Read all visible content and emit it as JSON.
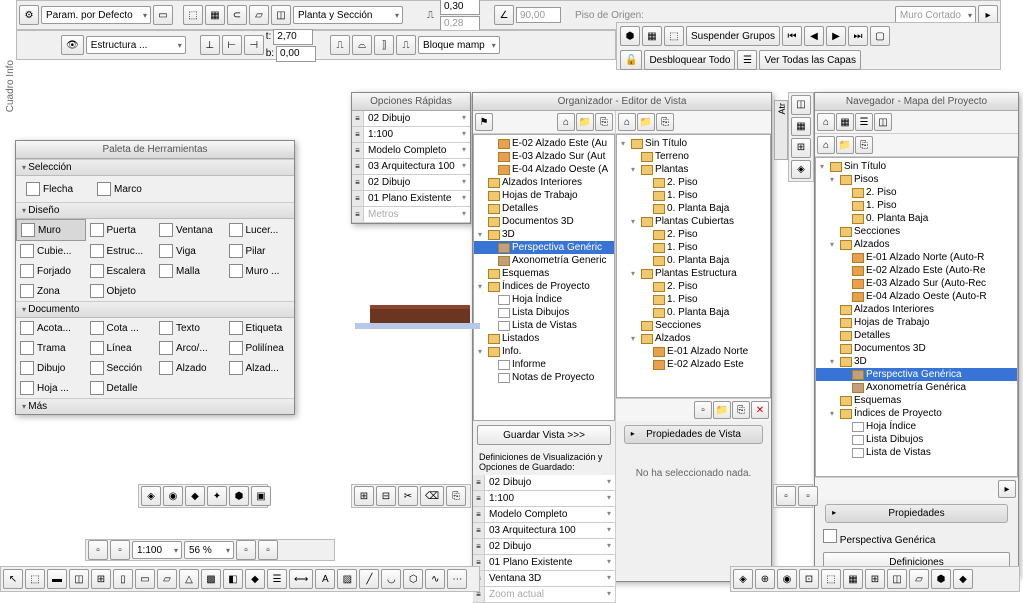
{
  "top": {
    "param_default": "Param. por Defecto",
    "planta_seccion": "Planta y Sección",
    "estruct": "Estructura ...",
    "bloque": "Bloque mamp",
    "t_label": "t:",
    "t_val": "2,70",
    "b_label": "b:",
    "b_val": "0,00",
    "v1": "0,30",
    "v2": "0,28",
    "angle": "90,00",
    "piso_origen": "Piso de Origen:",
    "muro_cortado": "Muro Cortado",
    "info": "Cuadro Info"
  },
  "layers": {
    "suspend": "Suspender Grupos",
    "unlock": "Desbloquear Todo",
    "showall": "Ver Todas las Capas"
  },
  "palette": {
    "title": "Paleta de Herramientas",
    "sections": {
      "sel": "Selección",
      "design": "Diseño",
      "doc": "Documento",
      "more": "Más"
    },
    "flecha": "Flecha",
    "marco": "Marco",
    "muro": "Muro",
    "puerta": "Puerta",
    "ventana": "Ventana",
    "lucer": "Lucer...",
    "cubie": "Cubie...",
    "estruc": "Estruc...",
    "viga": "Viga",
    "pilar": "Pilar",
    "forjado": "Forjado",
    "escalera": "Escalera",
    "malla": "Malla",
    "muroc": "Muro ...",
    "zona": "Zona",
    "objeto": "Objeto",
    "acota": "Acota...",
    "cota": "Cota ...",
    "texto": "Texto",
    "etiqueta": "Etiqueta",
    "trama": "Trama",
    "linea": "Línea",
    "arco": "Arco/...",
    "polilinea": "Polilínea",
    "dibujo": "Dibujo",
    "seccion": "Sección",
    "alzado": "Alzado",
    "alzad2": "Alzad...",
    "hoja": "Hoja ...",
    "detalle": "Detalle"
  },
  "opciones": {
    "title": "Opciones Rápidas",
    "items": [
      "02 Dibujo",
      "1:100",
      "Modelo Completo",
      "03 Arquitectura 100",
      "02 Dibujo",
      "01 Plano Existente",
      "Metros"
    ]
  },
  "organizador": {
    "title": "Organizador - Editor de Vista",
    "left_tree": [
      {
        "l": 1,
        "i": "home",
        "t": "E-02 Alzado Este (Au"
      },
      {
        "l": 1,
        "i": "home",
        "t": "E-03 Alzado Sur (Aut"
      },
      {
        "l": 1,
        "i": "home",
        "t": "E-04 Alzado Oeste (A"
      },
      {
        "l": 0,
        "i": "f",
        "t": "Alzados Interiores"
      },
      {
        "l": 0,
        "i": "f",
        "t": "Hojas de Trabajo"
      },
      {
        "l": 0,
        "i": "f",
        "t": "Detalles"
      },
      {
        "l": 0,
        "i": "f",
        "t": "Documentos 3D"
      },
      {
        "l": 0,
        "tri": "▾",
        "i": "f",
        "t": "3D"
      },
      {
        "l": 1,
        "i": "cube",
        "t": "Perspectiva Genéric",
        "sel": true
      },
      {
        "l": 1,
        "i": "cube",
        "t": "Axonometría Generic"
      },
      {
        "l": 0,
        "i": "f",
        "t": "Esquemas"
      },
      {
        "l": 0,
        "tri": "▾",
        "i": "f",
        "t": "Índices de Proyecto"
      },
      {
        "l": 1,
        "i": "doc",
        "t": "Hoja Índice"
      },
      {
        "l": 1,
        "i": "doc",
        "t": "Lista Dibujos"
      },
      {
        "l": 1,
        "i": "doc",
        "t": "Lista de Vistas"
      },
      {
        "l": 0,
        "i": "f",
        "t": "Listados"
      },
      {
        "l": 0,
        "tri": "▾",
        "i": "f",
        "t": "Info."
      },
      {
        "l": 1,
        "i": "doc",
        "t": "Informe"
      },
      {
        "l": 1,
        "i": "doc",
        "t": "Notas de Proyecto"
      }
    ],
    "right_tree": [
      {
        "l": 0,
        "tri": "▾",
        "i": "f",
        "t": "Sin Título"
      },
      {
        "l": 1,
        "i": "f",
        "t": "Terreno"
      },
      {
        "l": 1,
        "tri": "▾",
        "i": "f",
        "t": "Plantas"
      },
      {
        "l": 2,
        "i": "f",
        "t": "2. Piso"
      },
      {
        "l": 2,
        "i": "f",
        "t": "1. Piso"
      },
      {
        "l": 2,
        "i": "f",
        "t": "0. Planta Baja"
      },
      {
        "l": 1,
        "tri": "▾",
        "i": "f",
        "t": "Plantas Cubiertas"
      },
      {
        "l": 2,
        "i": "f",
        "t": "2. Piso"
      },
      {
        "l": 2,
        "i": "f",
        "t": "1. Piso"
      },
      {
        "l": 2,
        "i": "f",
        "t": "0. Planta Baja"
      },
      {
        "l": 1,
        "tri": "▾",
        "i": "f",
        "t": "Plantas Estructura"
      },
      {
        "l": 2,
        "i": "f",
        "t": "2. Piso"
      },
      {
        "l": 2,
        "i": "f",
        "t": "1. Piso"
      },
      {
        "l": 2,
        "i": "f",
        "t": "0. Planta Baja"
      },
      {
        "l": 1,
        "i": "f",
        "t": "Secciones"
      },
      {
        "l": 1,
        "tri": "▾",
        "i": "f",
        "t": "Alzados"
      },
      {
        "l": 2,
        "i": "home",
        "t": "E-01 Alzado Norte"
      },
      {
        "l": 2,
        "i": "home",
        "t": "E-02 Alzado Este"
      }
    ],
    "guardar": "Guardar Vista >>>",
    "defs_label": "Definiciones de Visualización y Opciones de Guardado:",
    "settings": [
      "02 Dibujo",
      "1:100",
      "Modelo Completo",
      "03 Arquitectura 100",
      "02 Dibujo",
      "01 Plano Existente",
      "Ventana 3D",
      "Zoom actual"
    ],
    "props_title": "Propiedades de Vista",
    "no_sel": "No ha seleccionado nada."
  },
  "navegador": {
    "title": "Navegador - Mapa del Proyecto",
    "tree": [
      {
        "l": 0,
        "tri": "▾",
        "i": "f",
        "t": "Sin Título"
      },
      {
        "l": 1,
        "tri": "▾",
        "i": "f",
        "t": "Pisos"
      },
      {
        "l": 2,
        "i": "f",
        "t": "2. Piso"
      },
      {
        "l": 2,
        "i": "f",
        "t": "1. Piso"
      },
      {
        "l": 2,
        "i": "f",
        "t": "0. Planta Baja"
      },
      {
        "l": 1,
        "i": "f",
        "t": "Secciones"
      },
      {
        "l": 1,
        "tri": "▾",
        "i": "f",
        "t": "Alzados"
      },
      {
        "l": 2,
        "i": "home",
        "t": "E-01 Alzado Norte (Auto-R"
      },
      {
        "l": 2,
        "i": "home",
        "t": "E-02 Alzado Este (Auto-Re"
      },
      {
        "l": 2,
        "i": "home",
        "t": "E-03 Alzado Sur (Auto-Rec"
      },
      {
        "l": 2,
        "i": "home",
        "t": "E-04 Alzado Oeste (Auto-R"
      },
      {
        "l": 1,
        "i": "f",
        "t": "Alzados Interiores"
      },
      {
        "l": 1,
        "i": "f",
        "t": "Hojas de Trabajo"
      },
      {
        "l": 1,
        "i": "f",
        "t": "Detalles"
      },
      {
        "l": 1,
        "i": "f",
        "t": "Documentos 3D"
      },
      {
        "l": 1,
        "tri": "▾",
        "i": "f",
        "t": "3D"
      },
      {
        "l": 2,
        "i": "cube",
        "t": "Perspectiva Genérica",
        "sel": true
      },
      {
        "l": 2,
        "i": "cube",
        "t": "Axonometría Genérica"
      },
      {
        "l": 1,
        "i": "f",
        "t": "Esquemas"
      },
      {
        "l": 1,
        "tri": "▾",
        "i": "f",
        "t": "Índices de Proyecto"
      },
      {
        "l": 2,
        "i": "doc",
        "t": "Hoja Índice"
      },
      {
        "l": 2,
        "i": "doc",
        "t": "Lista Dibujos"
      },
      {
        "l": 2,
        "i": "doc",
        "t": "Lista de Vistas"
      }
    ],
    "props": "Propiedades",
    "persp": "Perspectiva Genérica",
    "defs": "Definiciones"
  },
  "status": {
    "scale": "1:100",
    "zoom": "56 %"
  }
}
